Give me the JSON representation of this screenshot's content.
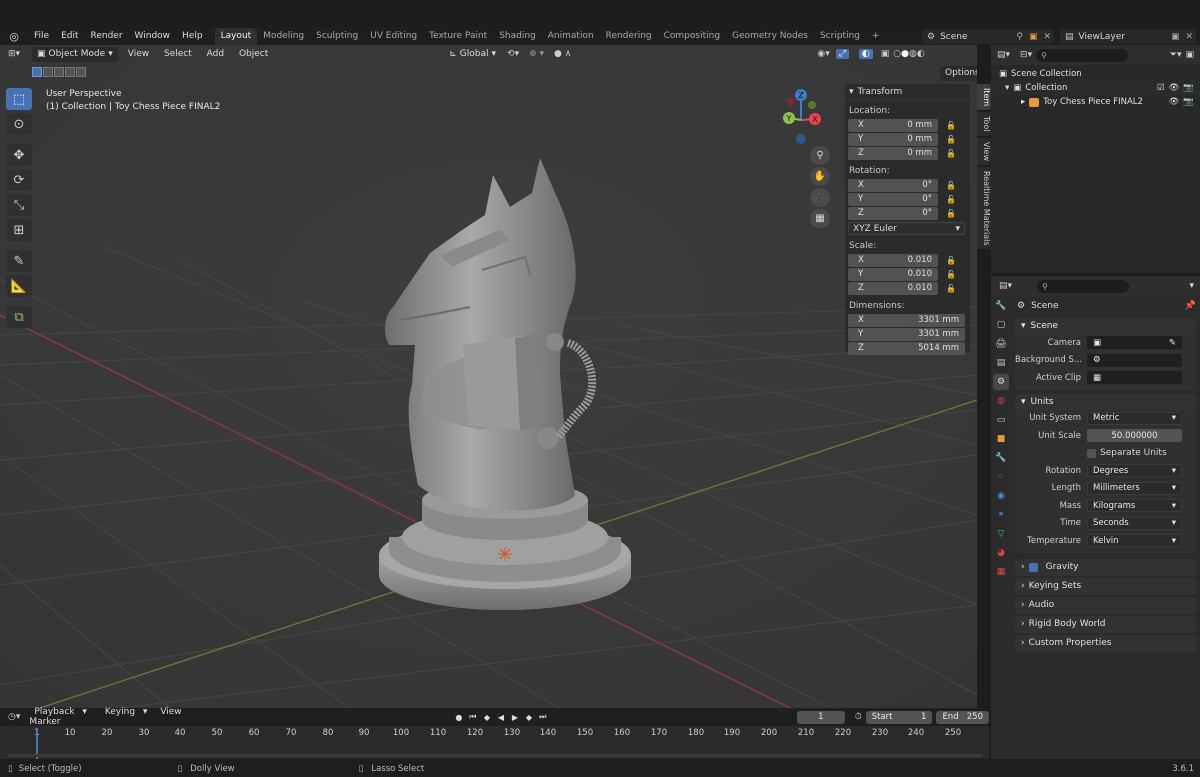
{
  "menu": [
    "File",
    "Edit",
    "Render",
    "Window",
    "Help"
  ],
  "workspaces": [
    "Layout",
    "Modeling",
    "Sculpting",
    "UV Editing",
    "Texture Paint",
    "Shading",
    "Animation",
    "Rendering",
    "Compositing",
    "Geometry Nodes",
    "Scripting"
  ],
  "active_workspace": "Layout",
  "add_tab": "+",
  "scene_name": "Scene",
  "view_layer": "ViewLayer",
  "viewport": {
    "mode": "Object Mode",
    "menu": [
      "View",
      "Select",
      "Add",
      "Object"
    ],
    "orientation": "Global",
    "options": "Options",
    "info_line1": "User Perspective",
    "info_line2": "(1) Collection | Toy Chess Piece FINAL2",
    "gizmo": {
      "x": "X",
      "y": "Y",
      "z": "Z"
    }
  },
  "npanel": {
    "header": "Transform",
    "location_label": "Location:",
    "location": [
      {
        "axis": "X",
        "value": "0 mm"
      },
      {
        "axis": "Y",
        "value": "0 mm"
      },
      {
        "axis": "Z",
        "value": "0 mm"
      }
    ],
    "rotation_label": "Rotation:",
    "rotation": [
      {
        "axis": "X",
        "value": "0°"
      },
      {
        "axis": "Y",
        "value": "0°"
      },
      {
        "axis": "Z",
        "value": "0°"
      }
    ],
    "rotation_mode": "XYZ Euler",
    "scale_label": "Scale:",
    "scale": [
      {
        "axis": "X",
        "value": "0.010"
      },
      {
        "axis": "Y",
        "value": "0.010"
      },
      {
        "axis": "Z",
        "value": "0.010"
      }
    ],
    "dimensions_label": "Dimensions:",
    "dimensions": [
      {
        "axis": "X",
        "value": "3301 mm"
      },
      {
        "axis": "Y",
        "value": "3301 mm"
      },
      {
        "axis": "Z",
        "value": "5014 mm"
      }
    ],
    "tabs": [
      "Item",
      "Tool",
      "View",
      "Realtime Materials"
    ]
  },
  "outliner": {
    "items": [
      {
        "label": "Scene Collection"
      },
      {
        "label": "Collection"
      },
      {
        "label": "Toy Chess Piece FINAL2"
      }
    ]
  },
  "properties": {
    "title": "Scene",
    "scene_section": "Scene",
    "camera_label": "Camera",
    "background_label": "Background S...",
    "active_clip_label": "Active Clip",
    "units_section": "Units",
    "unit_system_label": "Unit System",
    "unit_system": "Metric",
    "unit_scale_label": "Unit Scale",
    "unit_scale": "50.000000",
    "separate_units": "Separate Units",
    "rotation_label": "Rotation",
    "rotation": "Degrees",
    "length_label": "Length",
    "length": "Millimeters",
    "mass_label": "Mass",
    "mass": "Kilograms",
    "time_label": "Time",
    "time": "Seconds",
    "temperature_label": "Temperature",
    "temperature": "Kelvin",
    "collapsed": [
      "Gravity",
      "Keying Sets",
      "Audio",
      "Rigid Body World",
      "Custom Properties"
    ]
  },
  "timeline": {
    "menu": [
      "Playback",
      "Keying",
      "View",
      "Marker"
    ],
    "current_frame": "1",
    "start_label": "Start",
    "start": "1",
    "end_label": "End",
    "end": "250",
    "ticks": [
      "1",
      "10",
      "20",
      "30",
      "40",
      "50",
      "60",
      "70",
      "80",
      "90",
      "100",
      "110",
      "120",
      "130",
      "140",
      "150",
      "160",
      "170",
      "180",
      "190",
      "200",
      "210",
      "220",
      "230",
      "240",
      "250"
    ]
  },
  "status": {
    "select": "Select (Toggle)",
    "dolly": "Dolly View",
    "lasso": "Lasso Select",
    "version": "3.6.1"
  },
  "colors": {
    "accent": "#4772b3",
    "x_axis": "#e8434f",
    "y_axis": "#8bc34a",
    "z_axis": "#3d7ec9",
    "object": "#e59a3b"
  }
}
